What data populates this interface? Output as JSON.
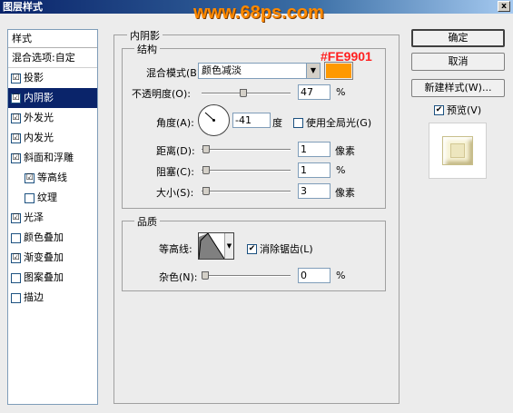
{
  "window": {
    "title": "图层样式",
    "close_label": "x"
  },
  "watermark": "www.68ps.com",
  "annotation_hex": "#FE9901",
  "colors": {
    "swatch": "#FE9901",
    "selection": "#0a246a"
  },
  "left_panel": {
    "header": "样式",
    "blend_options": "混合选项:自定",
    "items": [
      {
        "label": "投影",
        "checked": true,
        "mark": "☑"
      },
      {
        "label": "内阴影",
        "checked": true,
        "mark": "☑",
        "selected": true
      },
      {
        "label": "外发光",
        "checked": true,
        "mark": "☑"
      },
      {
        "label": "内发光",
        "checked": true,
        "mark": "☑"
      },
      {
        "label": "斜面和浮雕",
        "checked": true,
        "mark": "☑"
      },
      {
        "label": "等高线",
        "checked": true,
        "mark": "☑",
        "sub": true
      },
      {
        "label": "纹理",
        "checked": false,
        "mark": "",
        "sub": true
      },
      {
        "label": "光泽",
        "checked": true,
        "mark": "☑"
      },
      {
        "label": "颜色叠加",
        "checked": false,
        "mark": ""
      },
      {
        "label": "渐变叠加",
        "checked": true,
        "mark": "☑"
      },
      {
        "label": "图案叠加",
        "checked": false,
        "mark": ""
      },
      {
        "label": "描边",
        "checked": false,
        "mark": ""
      }
    ]
  },
  "inner_shadow": {
    "title": "内阴影",
    "structure": {
      "title": "结构",
      "blend_mode_label": "混合模式(B):",
      "blend_mode_value": "颜色减淡",
      "opacity_label": "不透明度(O):",
      "opacity_value": "47",
      "opacity_unit": "%",
      "angle_label": "角度(A):",
      "angle_value": "-41",
      "angle_unit": "度",
      "global_light_label": "使用全局光(G)",
      "distance_label": "距离(D):",
      "distance_value": "1",
      "distance_unit": "像素",
      "choke_label": "阻塞(C):",
      "choke_value": "1",
      "choke_unit": "%",
      "size_label": "大小(S):",
      "size_value": "3",
      "size_unit": "像素",
      "levels": {
        "opacity": 0.47,
        "distance": 0.01,
        "choke": 0.01,
        "size": 0.012
      }
    },
    "quality": {
      "title": "品质",
      "contour_label": "等高线:",
      "antialias_label": "消除锯齿(L)",
      "noise_label": "杂色(N):",
      "noise_value": "0",
      "noise_unit": "%",
      "levels": {
        "noise": 0.0
      }
    }
  },
  "buttons": {
    "ok": "确定",
    "cancel": "取消",
    "new_style": "新建样式(W)...",
    "preview_label": "预览(V)"
  }
}
